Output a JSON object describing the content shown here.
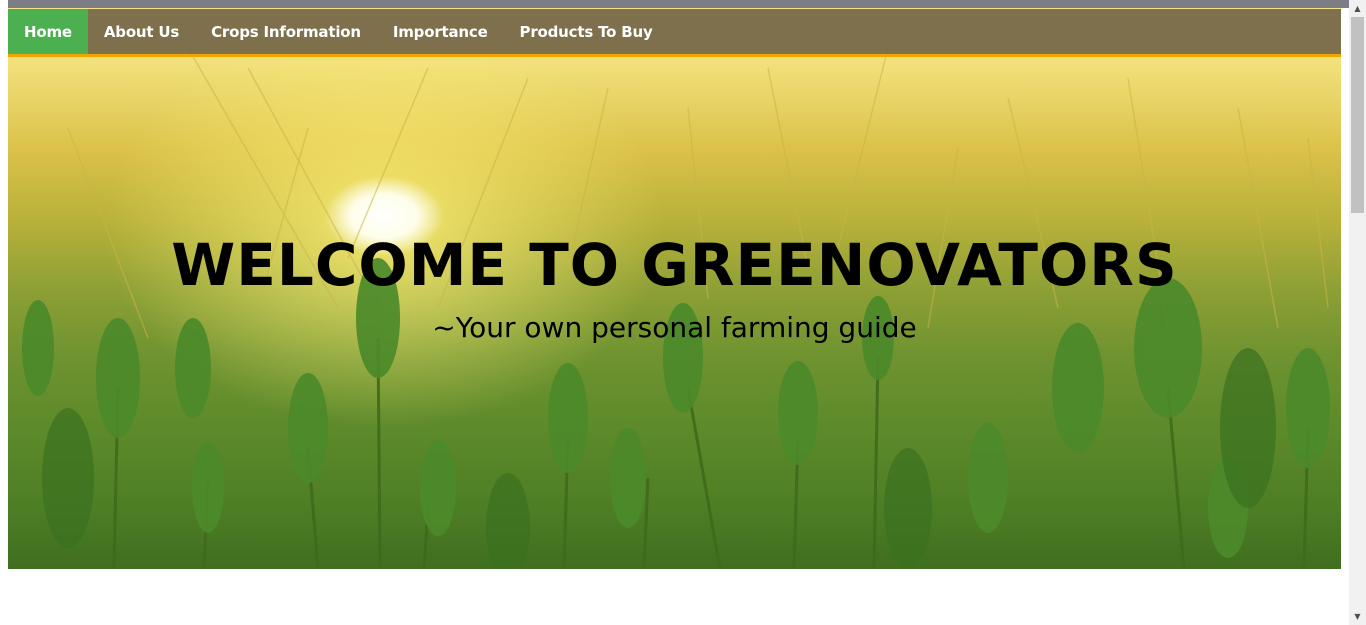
{
  "nav": {
    "items": [
      {
        "label": "Home",
        "active": true
      },
      {
        "label": "About Us",
        "active": false
      },
      {
        "label": "Crops Information",
        "active": false
      },
      {
        "label": "Importance",
        "active": false
      },
      {
        "label": "Products To Buy",
        "active": false
      }
    ]
  },
  "hero": {
    "title": "WELCOME TO GREENOVATORS",
    "subtitle": "~Your own personal farming guide"
  },
  "colors": {
    "nav_active": "#4caf50",
    "nav_border": "#f0a500",
    "nav_background": "#6e6046",
    "text": "#000000"
  },
  "icons": {
    "scroll_up": "scroll-up-arrow-icon",
    "scroll_down": "scroll-down-arrow-icon"
  }
}
